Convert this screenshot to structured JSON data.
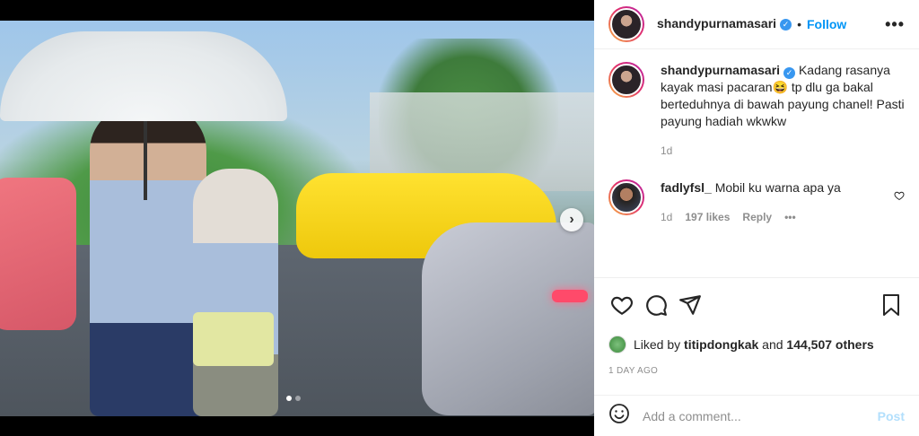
{
  "post": {
    "author": "shandypurnamasari",
    "follow_label": "Follow",
    "more_label": "•••",
    "separator": "•"
  },
  "caption": {
    "username": "shandypurnamasari",
    "text": "Kadang rasanya kayak masi pacaran😆 tp dlu ga bakal berteduhnya di bawah payung chanel! Pasti payung hadiah wkwkw",
    "age": "1d"
  },
  "comments": [
    {
      "username": "fadlyfsl_",
      "text": "Mobil ku warna apa ya",
      "age": "1d",
      "likes": "197 likes",
      "reply_label": "Reply",
      "more_label": "•••"
    }
  ],
  "carousel": {
    "current": 1,
    "total": 2,
    "next_label": "›"
  },
  "likes": {
    "prefix": "Liked by",
    "user": "titipdongkak",
    "connector": "and",
    "others": "144,507 others"
  },
  "timestamp": "1 DAY AGO",
  "composer": {
    "placeholder": "Add a comment...",
    "post_label": "Post"
  },
  "icons": {
    "verified": "verified-badge-icon",
    "like": "heart-icon",
    "comment": "comment-icon",
    "share": "share-icon",
    "save": "bookmark-icon",
    "emoji": "emoji-icon"
  },
  "colors": {
    "link": "#0095f6",
    "verified": "#3897f0",
    "muted": "#8e8e8e",
    "post_disabled": "#b2dffc"
  }
}
